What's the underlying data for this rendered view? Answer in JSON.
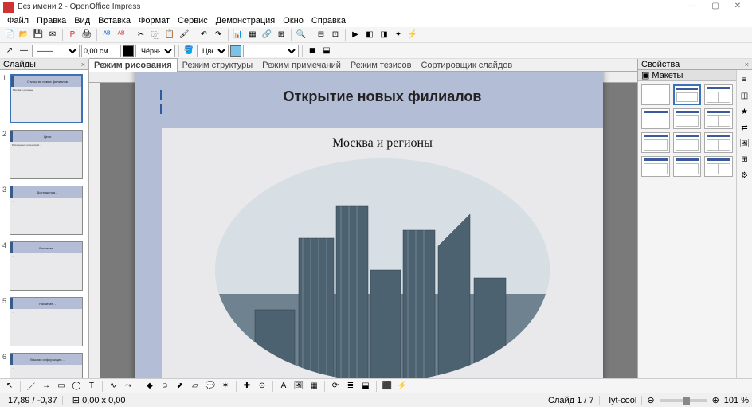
{
  "window": {
    "title": "Без имени 2 - OpenOffice Impress"
  },
  "menu": {
    "items": [
      "Файл",
      "Правка",
      "Вид",
      "Вставка",
      "Формат",
      "Сервис",
      "Демонстрация",
      "Окно",
      "Справка"
    ]
  },
  "toolbar2": {
    "line_width": "0,00 см",
    "color1": "Чёрный",
    "color_label": "Цвет"
  },
  "panels": {
    "slides_title": "Слайды",
    "props_title": "Свойства",
    "layouts_title": "Макеты"
  },
  "view_tabs": [
    "Режим рисования",
    "Режим структуры",
    "Режим примечаний",
    "Режим тезисов",
    "Сортировщик слайдов"
  ],
  "slide": {
    "title": "Открытие новых филиалов",
    "subtitle": "Москва и регионы"
  },
  "thumbs": [
    {
      "t": "Открытие новых филиалов",
      "b": "Москва и регионы"
    },
    {
      "t": "Цели",
      "b": "Расширение клиентской..."
    },
    {
      "t": "Достижения...",
      "b": "..."
    },
    {
      "t": "Развитие...",
      "b": "..."
    },
    {
      "t": "Развитие...",
      "b": "..."
    },
    {
      "t": "Важная информация...",
      "b": "..."
    }
  ],
  "status": {
    "coords": "17,89 / -0,37",
    "size": "0,00 x 0,00",
    "slide": "Слайд 1 / 7",
    "layout": "lyt-cool",
    "zoom": "101 %"
  }
}
